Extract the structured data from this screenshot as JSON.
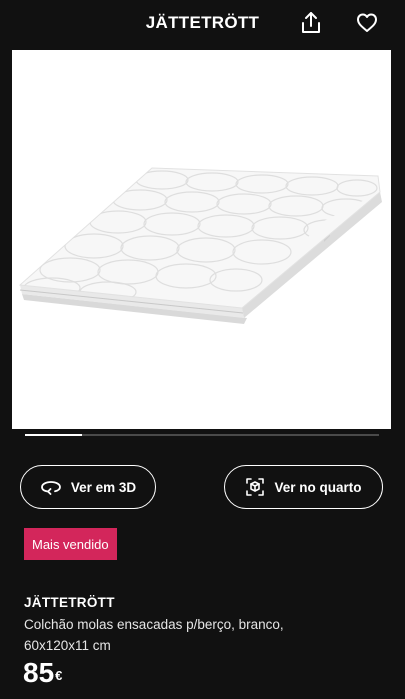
{
  "header": {
    "title": "JÄTTETRÖTT",
    "share_icon": "share-icon",
    "favorite_icon": "heart-icon"
  },
  "gallery": {
    "image": "mattress-photo",
    "progress": 0.16
  },
  "actions": {
    "view_3d_label": "Ver em 3D",
    "view_3d_icon": "rotate-3d-icon",
    "view_room_label": "Ver no quarto",
    "view_room_icon": "ar-cube-icon"
  },
  "badge": {
    "label": "Mais vendido",
    "color": "#d3265b"
  },
  "product": {
    "name": "JÄTTETRÖTT",
    "description": "Colchão molas ensacadas p/berço, branco, 60x120x11 cm",
    "price": "85",
    "currency": "€"
  }
}
